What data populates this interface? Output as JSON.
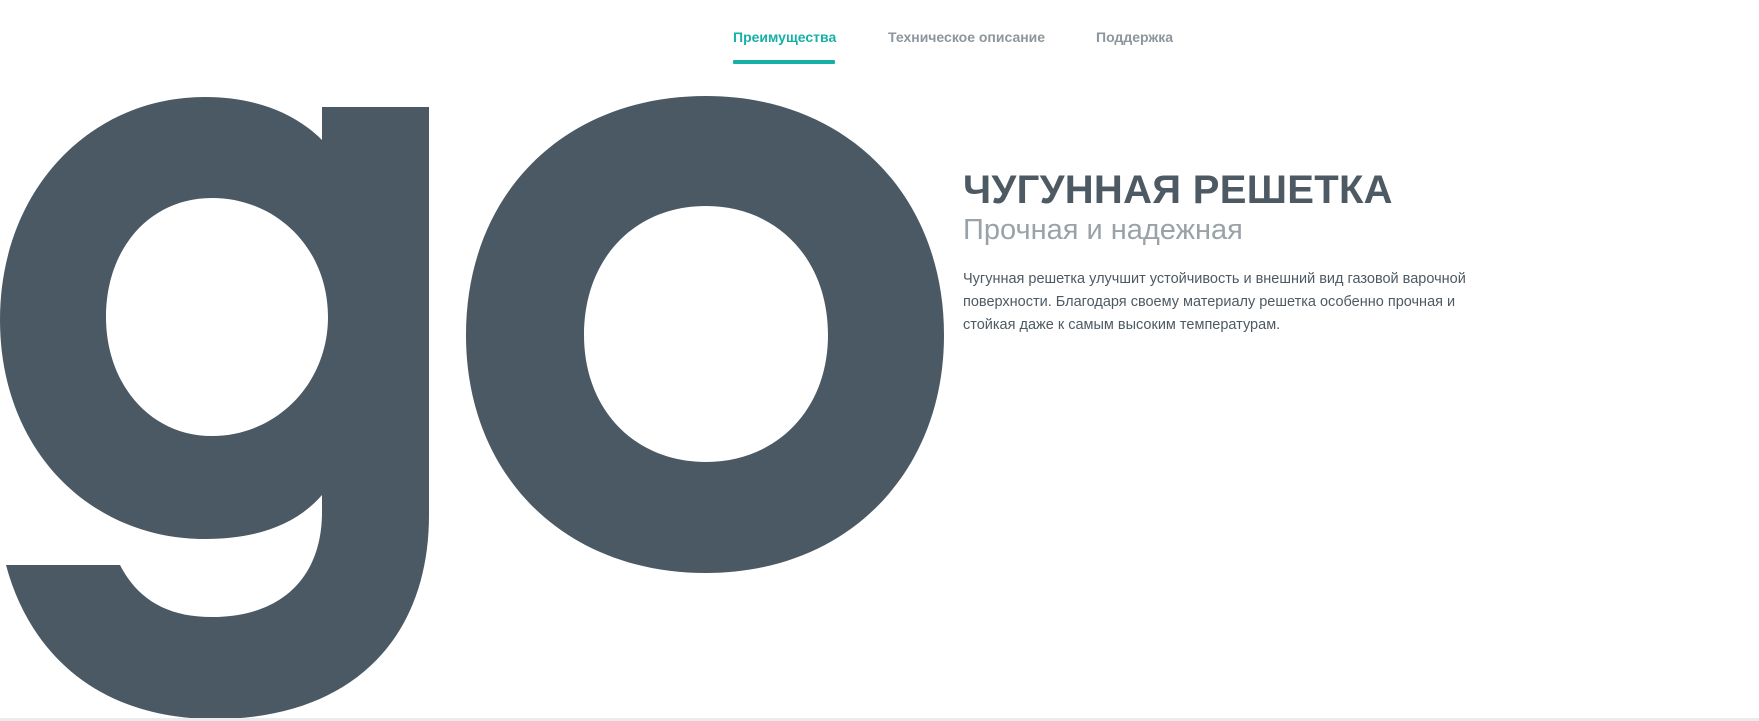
{
  "tabs": [
    {
      "label": "Преимущества",
      "active": true
    },
    {
      "label": "Техническое описание",
      "active": false
    },
    {
      "label": "Поддержка",
      "active": false
    }
  ],
  "hero": {
    "graphic_text": "go",
    "graphic_color": "#4a5963"
  },
  "product": {
    "title": "ЧУГУННАЯ РЕШЕТКА",
    "subtitle": "Прочная и надежная",
    "description": "Чугунная решетка улучшит устойчивость и внешний вид газовой варочной поверхности. Благодаря своему материалу решетка особенно прочная и стойкая даже к самым высоким температурам."
  },
  "colors": {
    "accent": "#17b0a7",
    "tab_inactive": "#8d969c",
    "title": "#4d5a63",
    "subtitle": "#9aa2a7"
  }
}
